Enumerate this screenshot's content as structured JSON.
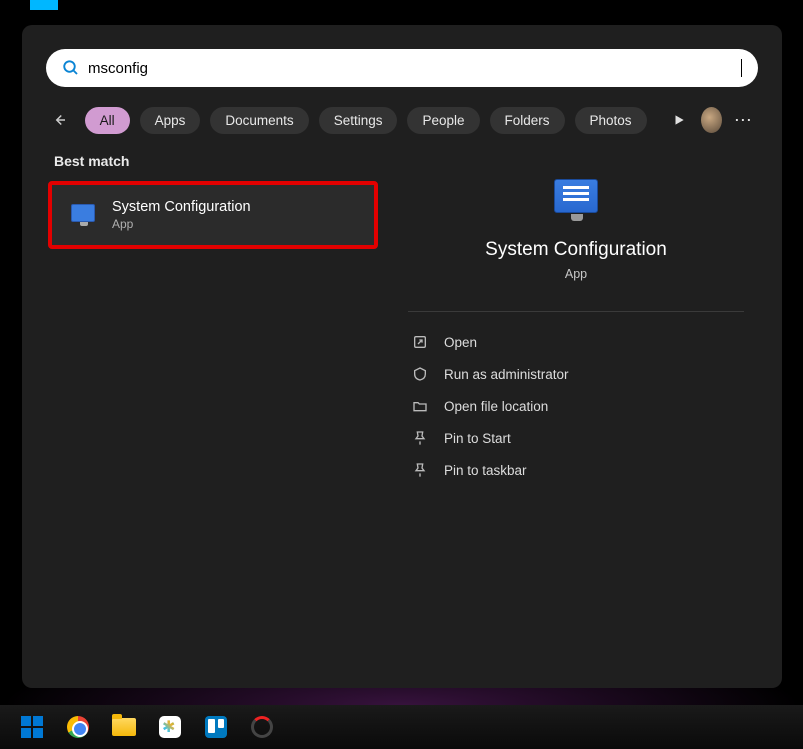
{
  "search": {
    "query": "msconfig",
    "icon": "search-icon"
  },
  "filters": {
    "items": [
      {
        "label": "All",
        "active": true
      },
      {
        "label": "Apps",
        "active": false
      },
      {
        "label": "Documents",
        "active": false
      },
      {
        "label": "Settings",
        "active": false
      },
      {
        "label": "People",
        "active": false
      },
      {
        "label": "Folders",
        "active": false
      },
      {
        "label": "Photos",
        "active": false
      }
    ]
  },
  "results": {
    "section_label": "Best match",
    "item": {
      "title": "System Configuration",
      "subtitle": "App"
    }
  },
  "detail": {
    "title": "System Configuration",
    "subtitle": "App",
    "actions": [
      {
        "label": "Open",
        "icon": "open-icon"
      },
      {
        "label": "Run as administrator",
        "icon": "shield-icon"
      },
      {
        "label": "Open file location",
        "icon": "folder-icon"
      },
      {
        "label": "Pin to Start",
        "icon": "pin-icon"
      },
      {
        "label": "Pin to taskbar",
        "icon": "pin-icon"
      }
    ]
  },
  "taskbar": {
    "items": [
      "windows",
      "chrome",
      "file-explorer",
      "slack",
      "trello",
      "app"
    ]
  }
}
